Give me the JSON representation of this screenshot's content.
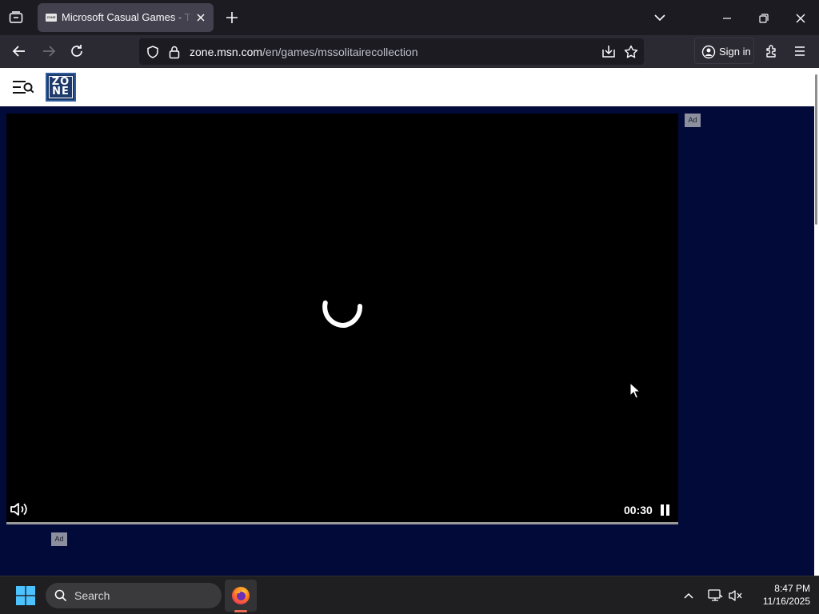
{
  "browser": {
    "tab": {
      "title": "Microsoft Casual Games - The Zone",
      "favicon_label": "ZONE"
    },
    "address_bar": {
      "host": "zone.msn.com",
      "path": "/en/games/mssolitairecollection"
    },
    "signin_label": "Sign in"
  },
  "page": {
    "logo_text_top": "ZO",
    "logo_text_bottom": "NE",
    "video": {
      "timer": "00:30",
      "progress_fraction": 1.0,
      "state": "loading"
    },
    "ads": {
      "label_side": "Ad",
      "label_bottom": "Ad"
    }
  },
  "taskbar": {
    "search_placeholder": "Search",
    "time": "8:47 PM",
    "date": "11/16/2025"
  },
  "colors": {
    "page_background": "#020a3a",
    "video_background": "#000000",
    "logo": "#1e3a6b"
  }
}
